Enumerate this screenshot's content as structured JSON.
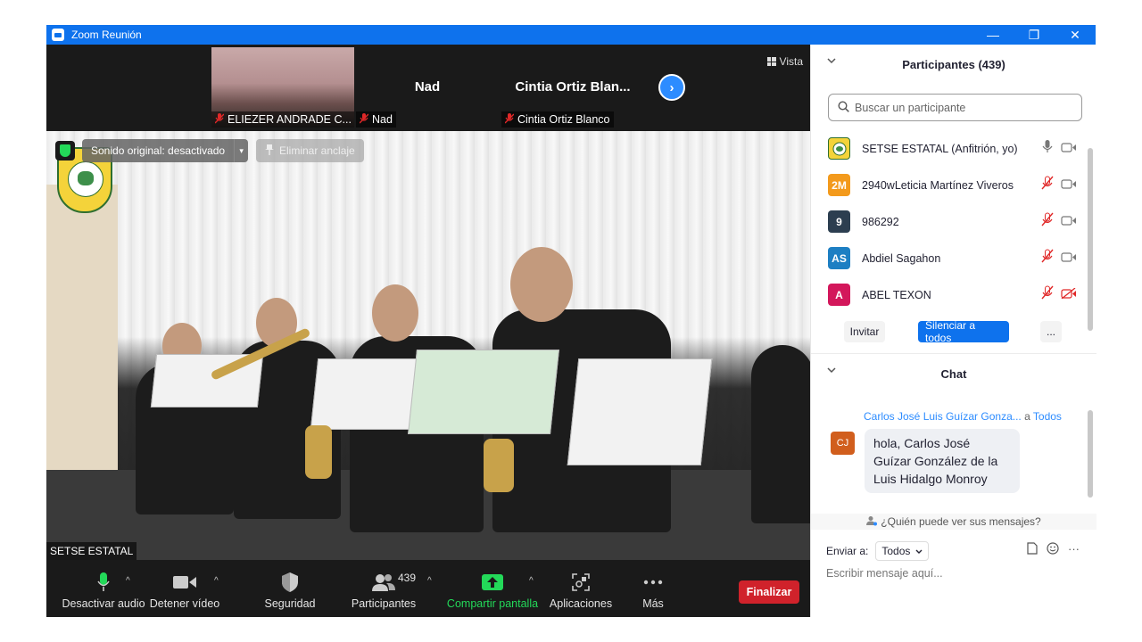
{
  "window": {
    "title": "Zoom Reunión",
    "controls": {
      "minimize": "—",
      "maximize": "❐",
      "close": "✕"
    }
  },
  "strip": {
    "thumbnails": [
      {
        "name": "ELIEZER ANDRADE C...",
        "has_video": true
      },
      {
        "name": "Nad",
        "big_name": "Nad",
        "has_video": false
      },
      {
        "name": "Cintia Ortiz Blanco",
        "big_name": "Cintia  Ortiz  Blan...",
        "has_video": false
      }
    ],
    "next_button": "›",
    "view_label": "Vista"
  },
  "main_video": {
    "sound_label": "Sonido original: desactivado",
    "sound_caret": "▾",
    "unpin_label": "Eliminar anclaje",
    "speaker_name": "SETSE ESTATAL"
  },
  "toolbar": {
    "items": [
      {
        "label": "Desactivar audio"
      },
      {
        "label": "Detener vídeo"
      },
      {
        "label": "Seguridad"
      },
      {
        "label": "Participantes",
        "count": "439"
      },
      {
        "label": "Compartir pantalla"
      },
      {
        "label": "Aplicaciones"
      },
      {
        "label": "Más"
      }
    ],
    "end_label": "Finalizar",
    "caret": "^"
  },
  "participants": {
    "header": "Participantes (439)",
    "search_placeholder": "Buscar un participante",
    "list": [
      {
        "initials": "",
        "name": "SETSE ESTATAL (Anfitrión, yo)",
        "color": "#f4d33a",
        "mic_muted": false,
        "video_off": false
      },
      {
        "initials": "2M",
        "name": "2940wLeticia Martínez Viveros",
        "color": "#f39a1c",
        "mic_muted": true,
        "video_off": false
      },
      {
        "initials": "9",
        "name": "986292",
        "color": "#2c3e50",
        "mic_muted": true,
        "video_off": false
      },
      {
        "initials": "AS",
        "name": "Abdiel Sagahon",
        "color": "#1d7fc3",
        "mic_muted": true,
        "video_off": false
      },
      {
        "initials": "A",
        "name": "ABEL TEXON",
        "color": "#d3175b",
        "mic_muted": true,
        "video_off": true
      }
    ],
    "invite_label": "Invitar",
    "mute_all_label": "Silenciar a todos",
    "more_label": "..."
  },
  "chat": {
    "header": "Chat",
    "sender": "Carlos José Luis Guízar Gonza...",
    "to_prefix": "a",
    "to": "Todos",
    "sender_initials": "CJ",
    "message": "hola, Carlos José Guízar González de la Luis Hidalgo Monroy",
    "who_sees": "¿Quién puede ver sus mensajes?",
    "send_to_label": "Enviar a:",
    "send_to_value": "Todos",
    "input_placeholder": "Escribir mensaje aquí...",
    "more_label": "···"
  },
  "colors": {
    "titlebar": "#0e72ed",
    "accent": "#2d8cff",
    "end_button": "#d0222b",
    "share_green": "#23d959",
    "mic_muted_red": "#e02828"
  }
}
